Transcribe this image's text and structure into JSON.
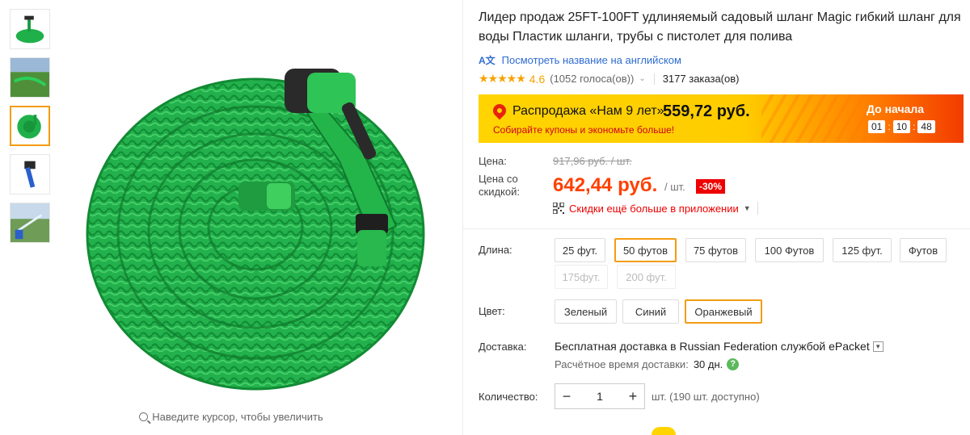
{
  "product": {
    "title": "Лидер продаж 25FT-100FT удлиняемый садовый шланг Magic гибкий шланг для воды Пластик шланги, трубы с пистолет для полива",
    "translate_link": "Посмотреть название на английском",
    "rating": "4.6",
    "stars": "★★★★★",
    "votes": "(1052 голоса(ов))",
    "orders": "3177 заказа(ов)"
  },
  "promo": {
    "sale_text": "Распродажа «Нам 9 лет»",
    "sale_price": "559,72 руб.",
    "subtitle": "Собирайте купоны и экономьте больше!",
    "until_label": "До начала",
    "timer": {
      "h": "01",
      "m": "10",
      "s": "48"
    }
  },
  "price": {
    "label_price": "Цена:",
    "old_price": "917,96 руб. / шт.",
    "label_discount": "Цена со скидкой:",
    "discount_price": "642,44 руб.",
    "unit": "/ шт.",
    "discount_badge": "-30%",
    "app_promo": "Скидки ещё больше в приложении"
  },
  "options": {
    "length_label": "Длина:",
    "lengths": [
      "25 фут.",
      "50 футов",
      "75 футов",
      "100 Футов",
      "125 фут.",
      "Футов",
      "175фут.",
      "200 фут."
    ],
    "length_selected": "50 футов",
    "color_label": "Цвет:",
    "colors": [
      "Зеленый",
      "Синий",
      "Оранжевый"
    ],
    "color_selected": "Оранжевый"
  },
  "shipping": {
    "label": "Доставка:",
    "text": "Бесплатная доставка в Russian Federation службой ePacket",
    "time_label": "Расчётное время доставки:",
    "time_value": "30 дн."
  },
  "quantity": {
    "label": "Количество:",
    "value": "1",
    "available": "шт. (190 шт. доступно)"
  },
  "gallery": {
    "zoom_hint": "Наведите курсор, чтобы увеличить"
  },
  "colors": {
    "accent": "#f39c12",
    "price": "#ff4000",
    "link": "#2e6cd1",
    "hose_green": "#22b14c"
  }
}
